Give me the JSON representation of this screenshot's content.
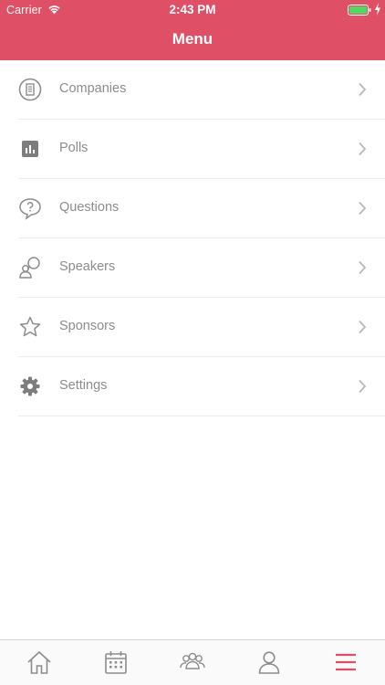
{
  "status_bar": {
    "carrier": "Carrier",
    "time": "2:43 PM"
  },
  "header": {
    "title": "Menu"
  },
  "colors": {
    "accent": "#df4f65",
    "icon_gray": "#8c8c8c",
    "label_gray": "#8c8c8c"
  },
  "menu": {
    "items": [
      {
        "label": "Companies",
        "icon": "building-icon"
      },
      {
        "label": "Polls",
        "icon": "bar-chart-icon"
      },
      {
        "label": "Questions",
        "icon": "question-bubble-icon"
      },
      {
        "label": "Speakers",
        "icon": "speaker-icon"
      },
      {
        "label": "Sponsors",
        "icon": "star-icon"
      },
      {
        "label": "Settings",
        "icon": "gear-icon"
      }
    ]
  },
  "tab_bar": {
    "tabs": [
      {
        "icon": "home-icon",
        "active": false
      },
      {
        "icon": "calendar-icon",
        "active": false
      },
      {
        "icon": "people-icon",
        "active": false
      },
      {
        "icon": "profile-icon",
        "active": false
      },
      {
        "icon": "hamburger-menu-icon",
        "active": true
      }
    ]
  }
}
